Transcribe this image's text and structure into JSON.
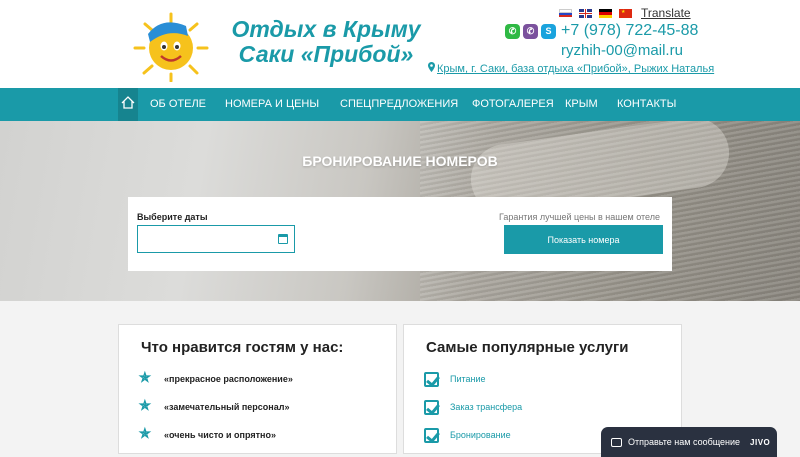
{
  "header": {
    "brand_line1": "Отдых в Крыму",
    "brand_line2": "Саки «Прибой»",
    "translate_label": "Translate",
    "languages": [
      "ru",
      "en",
      "de",
      "zh"
    ],
    "messenger_icons": [
      "whatsapp-icon",
      "viber-icon",
      "skype-icon"
    ],
    "phone": "+7 (978) 722-45-88",
    "email": "ryzhih-00@mail.ru",
    "address": "Крым, г. Саки, база отдыха «Прибой», Рыжих Наталья",
    "colors": {
      "accent": "#1a9aa8",
      "sun": "#f6c21c"
    }
  },
  "nav": {
    "home_icon": "home-icon",
    "items": [
      "ОБ ОТЕЛЕ",
      "НОМЕРА И ЦЕНЫ",
      "СПЕЦПРЕДЛОЖЕНИЯ",
      "ФОТОГАЛЕРЕЯ",
      "КРЫМ",
      "КОНТАКТЫ"
    ]
  },
  "hero": {
    "title": "БРОНИРОВАНИЕ НОМЕРОВ",
    "dates_label": "Выберите даты",
    "date_value": "",
    "guarantee": "Гарантия лучшей цены в нашем отеле",
    "show_button": "Показать номера"
  },
  "likes": {
    "title": "Что нравится гостям у нас:",
    "items": [
      "«прекрасное расположение»",
      "«замечательный персонал»",
      "«очень чисто и опрятно»"
    ]
  },
  "services": {
    "title": "Самые популярные услуги",
    "items": [
      "Питание",
      "Заказ трансфера",
      "Бронирование"
    ]
  },
  "chat": {
    "label": "Отправьте нам сообщение",
    "brand": "JIVO"
  }
}
